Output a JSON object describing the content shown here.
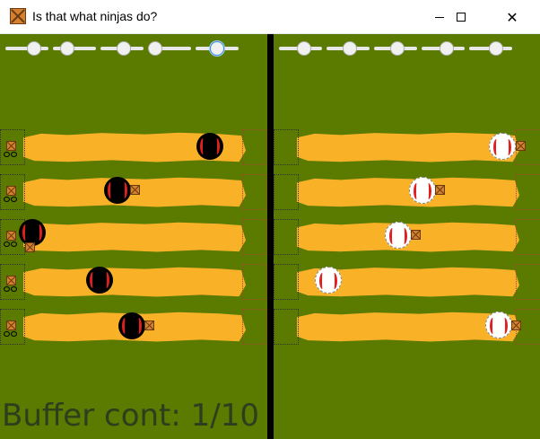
{
  "window": {
    "title": "Is that what ninjas do?",
    "minimize_glyph": "minimize",
    "maximize_glyph": "maximize",
    "close_glyph": "✕"
  },
  "colors": {
    "field": "#5a7a00",
    "road": "#f9b227",
    "ninja_dark": "#000000",
    "ninja_light": "#ffffff",
    "accent": "#e02020"
  },
  "left_panel": {
    "slider_count": 5,
    "buffer_text": "Buffer cont: 1/10"
  },
  "right_panel": {
    "slider_count": 5
  }
}
